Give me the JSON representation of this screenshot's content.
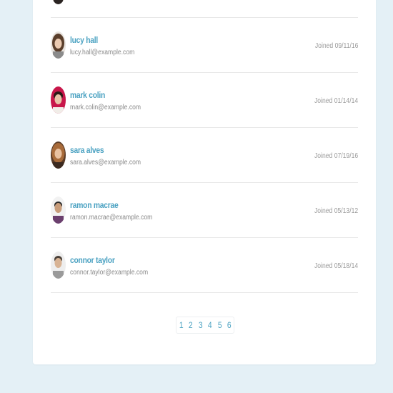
{
  "users": [
    {
      "name": "",
      "email": "",
      "joined": ""
    },
    {
      "name": "lucy hall",
      "email": "lucy.hall@example.com",
      "joined": "Joined 09/11/16"
    },
    {
      "name": "mark colin",
      "email": "mark.colin@example.com",
      "joined": "Joined 01/14/14"
    },
    {
      "name": "sara alves",
      "email": "sara.alves@example.com",
      "joined": "Joined 07/19/16"
    },
    {
      "name": "ramon macrae",
      "email": "ramon.macrae@example.com",
      "joined": "Joined 05/13/12"
    },
    {
      "name": "connor taylor",
      "email": "connor.taylor@example.com",
      "joined": "Joined 05/18/14"
    }
  ],
  "pagination": {
    "pages": [
      "1",
      "2",
      "3",
      "4",
      "5",
      "6"
    ]
  },
  "colors": {
    "background": "#e4f0f6",
    "card": "#ffffff",
    "accent": "#4ba2c2",
    "muted_text": "#8a8a8a"
  }
}
